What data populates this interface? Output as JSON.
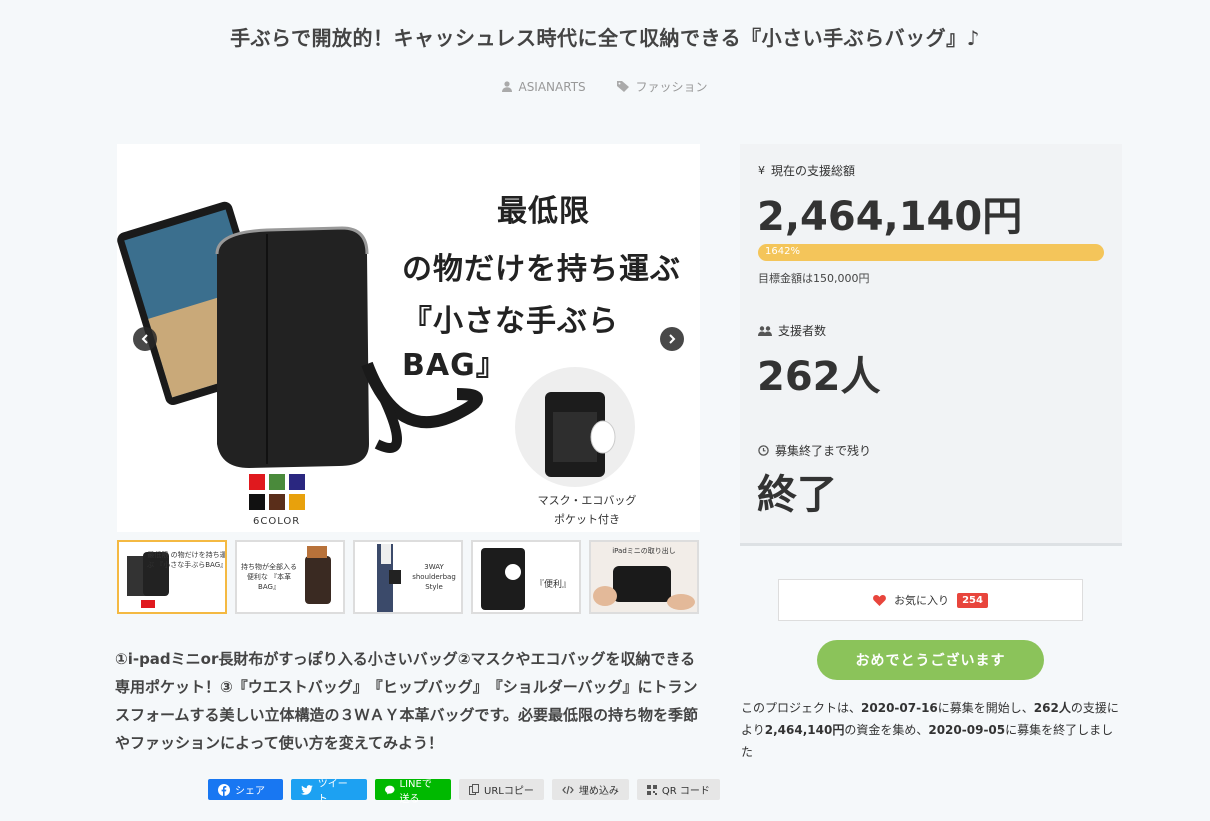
{
  "project": {
    "title": "手ぶらで開放的！キャッシュレス時代に全て収納できる『小さい手ぶらバッグ』♪",
    "author": "ASIANARTS",
    "category": "ファッション"
  },
  "image": {
    "headline_lines": [
      "最低限",
      "の物だけを持ち運ぶ",
      "『小さな手ぶらBAG』"
    ],
    "color_count": "6COLOR",
    "swatch_colors": [
      "#e0191e",
      "#4a8a3b",
      "#2a2780",
      "#111111",
      "#5a2e1a",
      "#e8a10c"
    ],
    "pocket_note_1": "マスク・エコバッグ",
    "pocket_note_2": "ポケット付き"
  },
  "thumbnails": [
    {
      "label": "最低限 の物だけを持ち運ぶ 『小さな手ぶらBAG』"
    },
    {
      "label": "持ち物が全部入る 便利な 『本革BAG』"
    },
    {
      "label": "3WAY shoulderbag Style"
    },
    {
      "label": "『便利』"
    },
    {
      "label": "iPadミニの取り出し"
    }
  ],
  "description": "①i-padミニor長財布がすっぽり入る小さいバッグ②マスクやエコバッグを収納できる専用ポケット！③『ウエストバッグ』　『ヒップバッグ』　『ショルダーバッグ』にトランスフォームする美しい立体構造の３ＷＡＹ本革バッグです。必要最低限の持ち物を季節やファッションによって使い方を変えてみよう！",
  "share": {
    "facebook": "シェア",
    "twitter": "ツイート",
    "line": "LINEで送る",
    "url_copy": "URLコピー",
    "embed": "埋め込み",
    "qr": "QR コード"
  },
  "stats": {
    "funding_label": "現在の支援総額",
    "funding_amount": "2,464,140円",
    "progress_text": "1642%",
    "progress_percent": 1642,
    "goal": "目標金額は150,000円",
    "backers_label": "支援者数",
    "backers": "262人",
    "remaining_label": "募集終了まで残り",
    "remaining": "終了"
  },
  "favorite": {
    "label": "お気に入り",
    "count": "254"
  },
  "congrats_button": "おめでとうございます",
  "summary": {
    "p1": "このプロジェクトは、",
    "start": "2020-07-16",
    "p2": "に募集を開始し、",
    "backers": "262人",
    "p3": "の支援により",
    "amount": "2,464,140円",
    "p4": "の資金を集め、",
    "end": "2020-09-05",
    "p5": "に募集を終了しました"
  },
  "colors": {
    "accent_green": "#8bc35a",
    "progress": "#f4c55a",
    "heart": "#e8453c"
  }
}
